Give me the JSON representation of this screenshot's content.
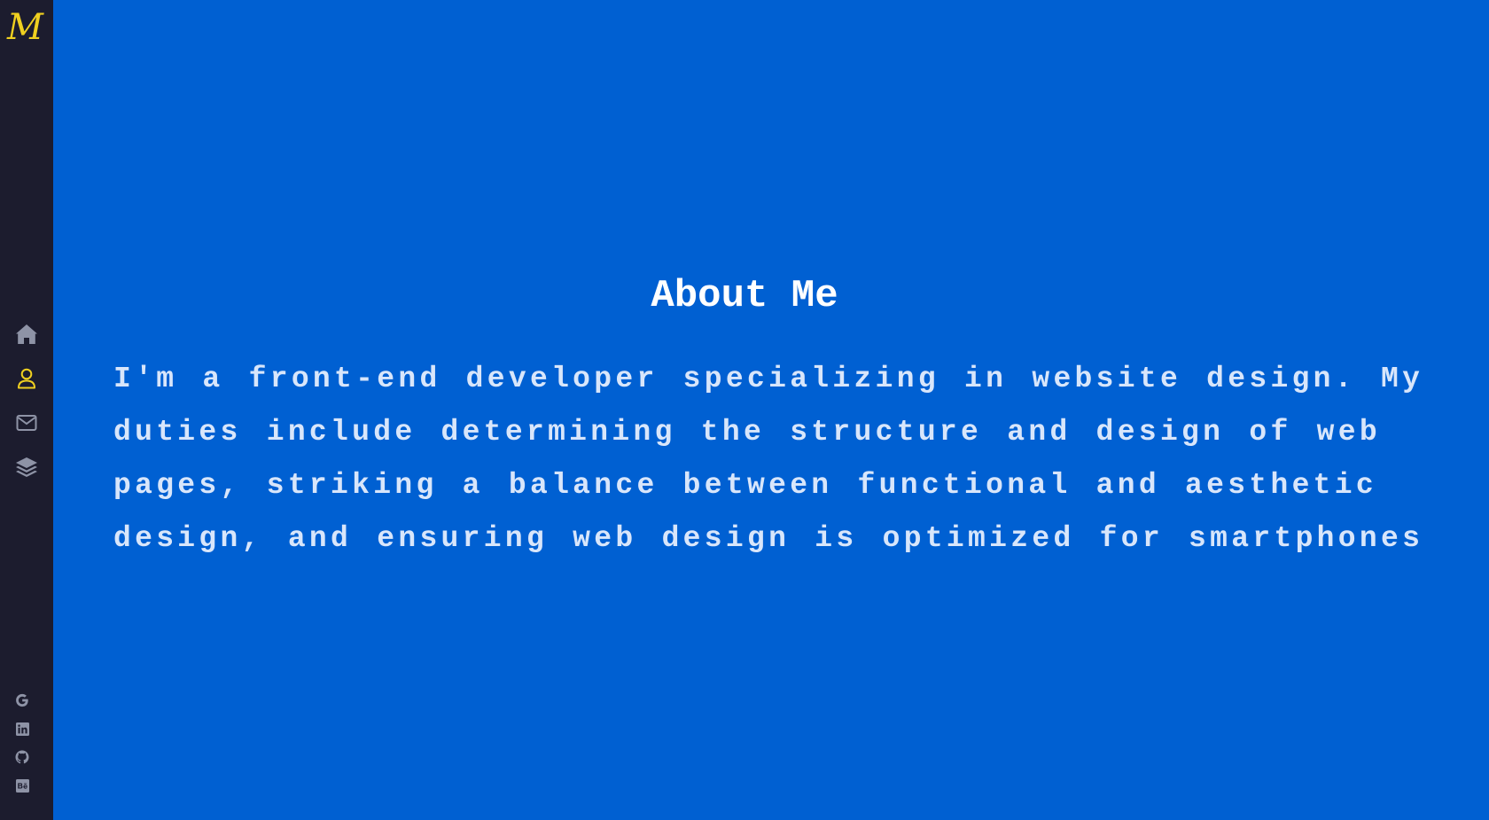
{
  "logo": {
    "text": "M"
  },
  "nav": {
    "items": [
      {
        "icon": "home-icon",
        "label": "Home"
      },
      {
        "icon": "user-icon",
        "label": "About",
        "active": true
      },
      {
        "icon": "mail-icon",
        "label": "Contact"
      },
      {
        "icon": "layers-icon",
        "label": "Projects"
      }
    ]
  },
  "social": {
    "items": [
      {
        "icon": "google-icon"
      },
      {
        "icon": "linkedin-icon"
      },
      {
        "icon": "github-icon"
      },
      {
        "icon": "behance-icon"
      }
    ]
  },
  "about": {
    "title": "About Me",
    "body": "I'm a front-end developer specializing in website design. My duties include determining the structure and design of web pages, striking a balance between functional and aesthetic design, and ensuring web design is optimized for smartphones"
  },
  "colors": {
    "background": "#0060d2",
    "sidebar": "#1c1c2e",
    "accent": "#f0d020",
    "icon_inactive": "#8e93a6",
    "body_text": "#d8e6fb",
    "title_text": "#ffffff"
  }
}
